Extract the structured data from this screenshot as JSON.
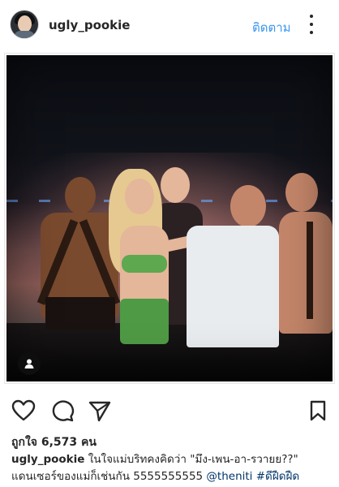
{
  "post": {
    "username": "ugly_pookie",
    "follow_label": "ติดตาม",
    "likes_text": "ถูกใจ 6,573 คน",
    "caption": {
      "username": "ugly_pookie",
      "line1": "ในใจแม่บริทคงคิดว่า \"มึง-เพน-อา-รวายย??\"",
      "line2": "แดนเซอร์ของแม่ก็เช่นกัน 5555555555",
      "mention": "@theniti",
      "hashtag": "#ดีฝืดฝืด"
    }
  },
  "icons": {
    "more": "more-options-icon",
    "like": "heart-icon",
    "comment": "comment-icon",
    "share": "share-icon",
    "save": "bookmark-icon",
    "tag": "person-tag-icon"
  },
  "colors": {
    "link": "#3897f0",
    "hashtag": "#003569",
    "text": "#262626"
  }
}
